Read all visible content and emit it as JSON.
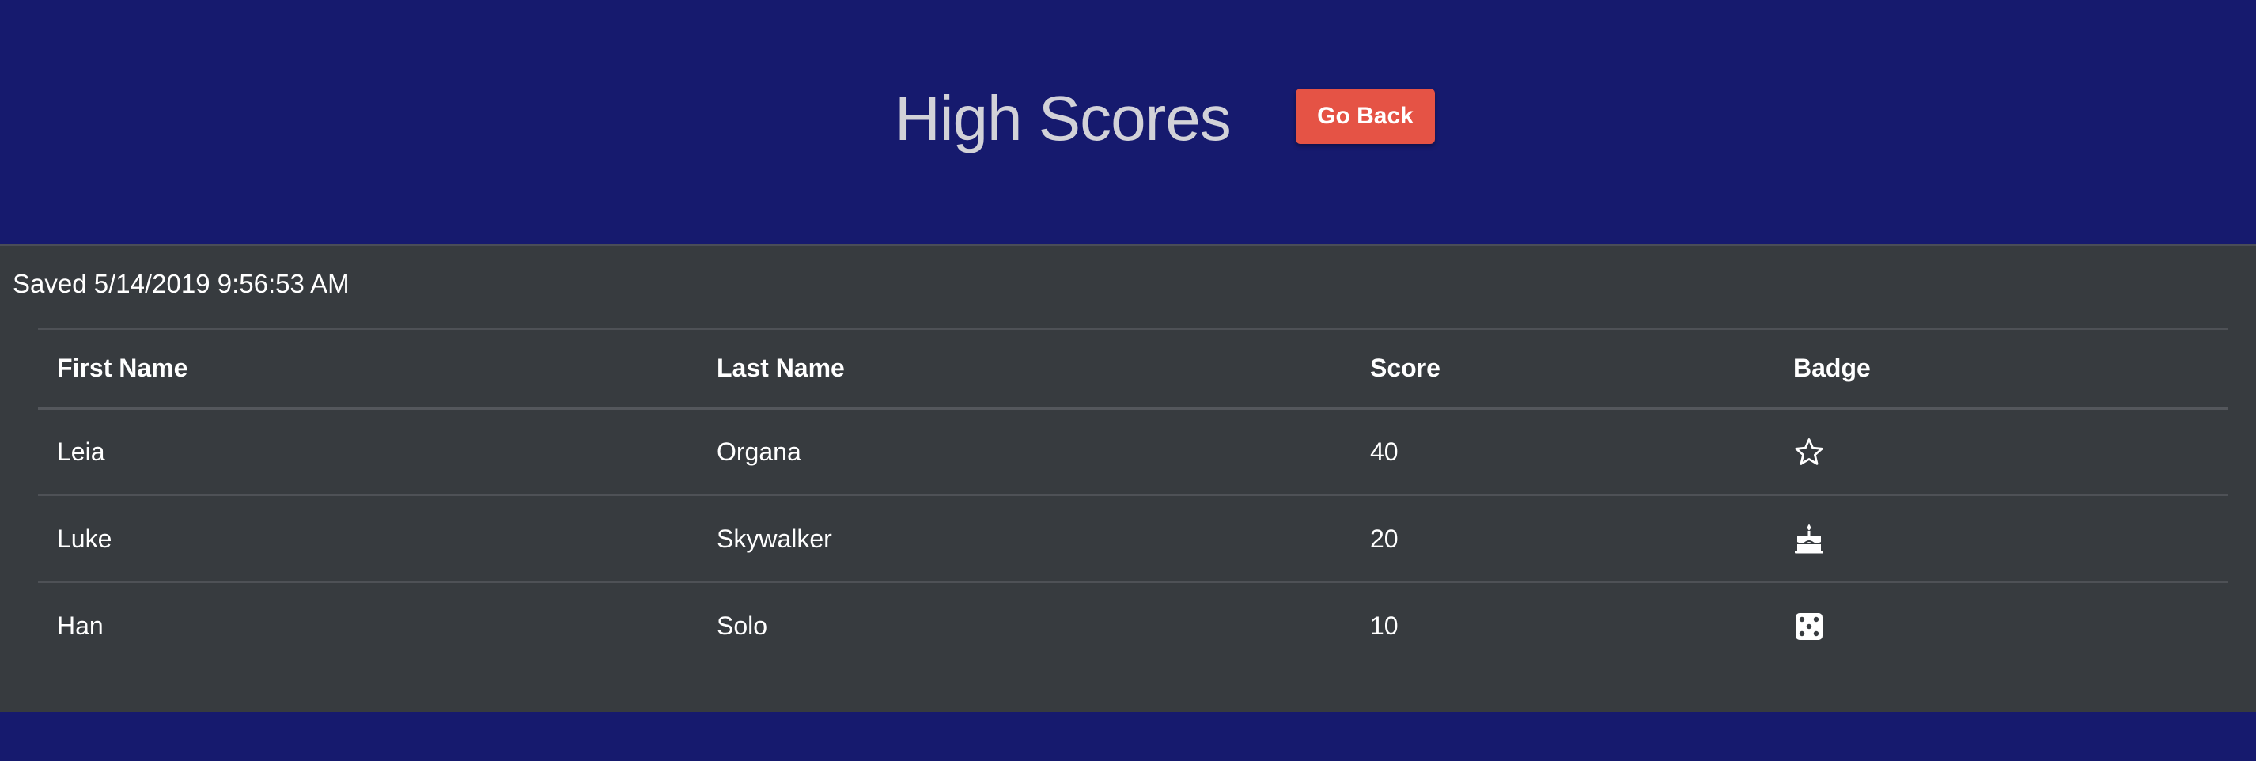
{
  "header": {
    "title": "High Scores",
    "go_back_label": "Go Back"
  },
  "saved_text": "Saved 5/14/2019 9:56:53 AM",
  "table": {
    "columns": [
      "First Name",
      "Last Name",
      "Score",
      "Badge"
    ],
    "rows": [
      {
        "first_name": "Leia",
        "last_name": "Organa",
        "score": "40",
        "badge": "star-icon"
      },
      {
        "first_name": "Luke",
        "last_name": "Skywalker",
        "score": "20",
        "badge": "birthday-cake-icon"
      },
      {
        "first_name": "Han",
        "last_name": "Solo",
        "score": "10",
        "badge": "dice-icon"
      }
    ]
  },
  "colors": {
    "background": "#161a6e",
    "panel": "#373b3f",
    "title": "#d2d2d8",
    "button": "#e55345",
    "text": "#ffffff"
  }
}
